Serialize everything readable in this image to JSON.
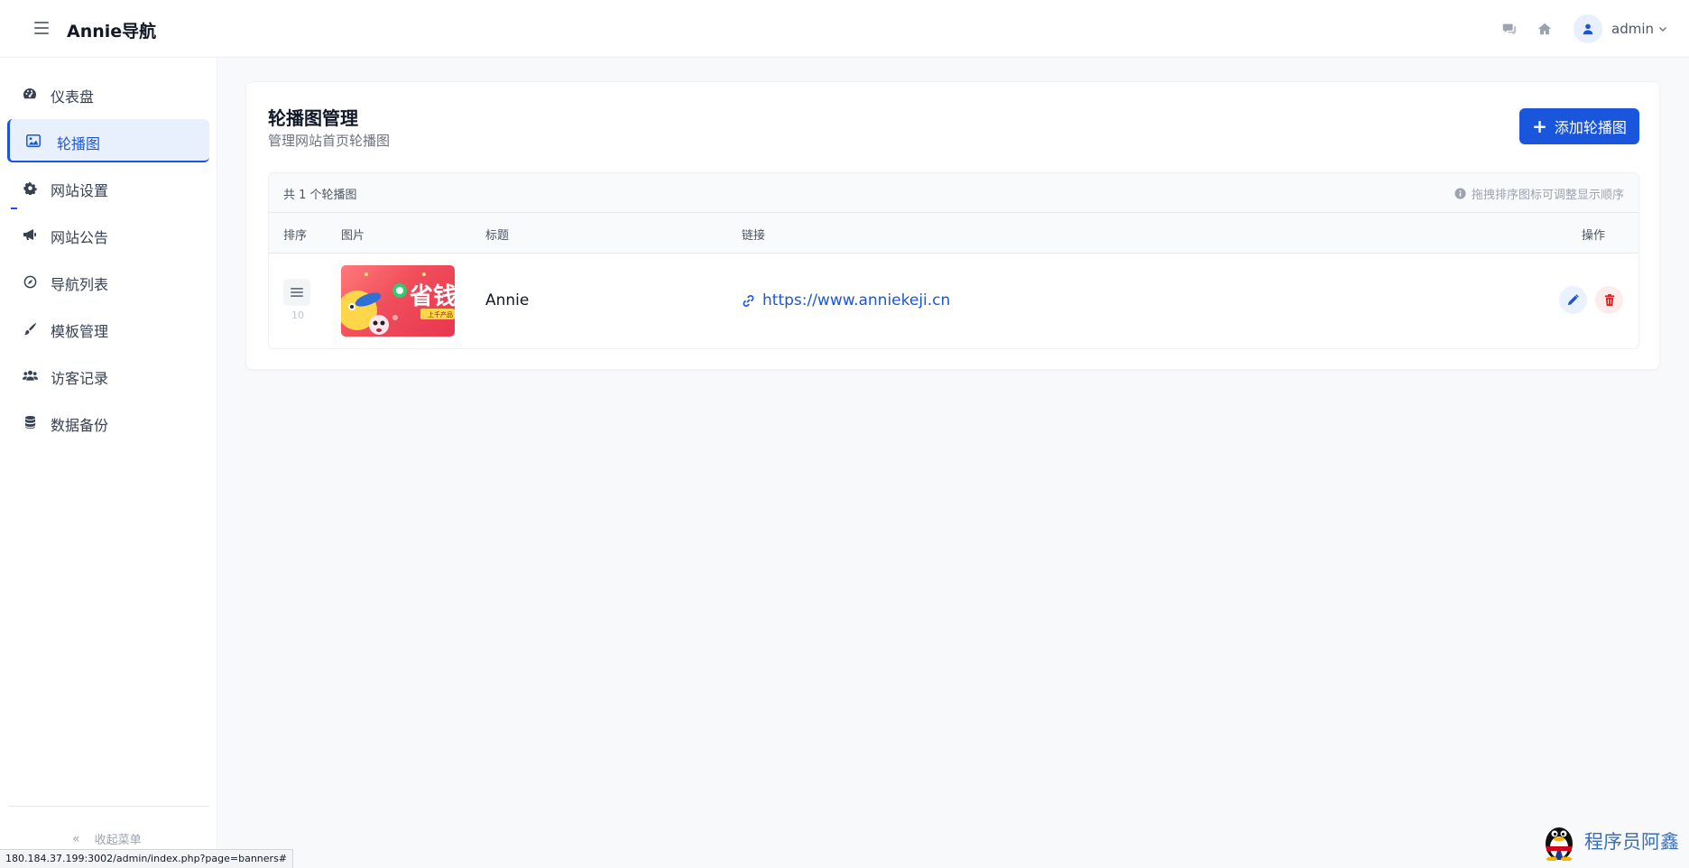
{
  "header": {
    "brand": "Annie导航",
    "user_name": "admin"
  },
  "sidebar": {
    "items": [
      {
        "label": "仪表盘",
        "icon": "dashboard-icon"
      },
      {
        "label": "轮播图",
        "icon": "image-icon",
        "active": true
      },
      {
        "label": "网站设置",
        "icon": "gear-icon"
      },
      {
        "label": "网站公告",
        "icon": "megaphone-icon"
      },
      {
        "label": "导航列表",
        "icon": "compass-icon"
      },
      {
        "label": "模板管理",
        "icon": "brush-icon"
      },
      {
        "label": "访客记录",
        "icon": "users-icon"
      },
      {
        "label": "数据备份",
        "icon": "database-icon"
      }
    ],
    "collapse_label": "收起菜单"
  },
  "main": {
    "title": "轮播图管理",
    "subtitle": "管理网站首页轮播图",
    "add_button": "添加轮播图",
    "count_text": "共 1 个轮播图",
    "hint": "拖拽排序图标可调整显示顺序",
    "columns": [
      "排序",
      "图片",
      "标题",
      "链接",
      "操作"
    ],
    "rows": [
      {
        "sort": "10",
        "thumb_text": "省钱",
        "thumb_sub": "上千产品",
        "title": "Annie",
        "link": "https://www.anniekeji.cn"
      }
    ]
  },
  "statusbar": {
    "url": "180.184.37.199:3002/admin/index.php?page=banners#"
  },
  "watermark": {
    "text": "程序员阿鑫"
  },
  "colors": {
    "primary": "#1a56db",
    "danger": "#dc2626",
    "active_bg": "#e8f0fe"
  }
}
